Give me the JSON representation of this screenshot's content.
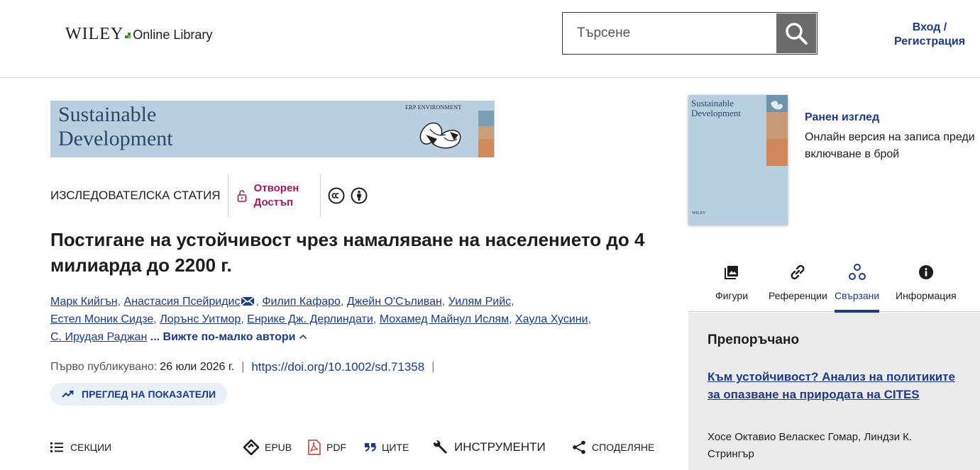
{
  "header": {
    "logo_wordmark": "WILEY",
    "logo_library": "Online Library",
    "search_placeholder": "Търсене",
    "login_line1": "Вход /",
    "login_line2": "Регистрация"
  },
  "banner": {
    "journal_title_line1": "Sustainable",
    "journal_title_line2": "Development",
    "publisher_mark": "ERP ENVIRONMENT"
  },
  "article": {
    "type": "ИЗСЛЕДОВАТЕЛСКА СТАТИЯ",
    "access_line1": "Отворен",
    "access_line2": "Достъп",
    "title": "Постигане на устойчивост чрез намаляване на населението до 4 милиарда до 2200 г.",
    "authors": [
      "Марк Кийгън",
      "Анастасия Псейридис",
      "Филип Кафаро",
      "Джейн О'Съливан",
      "Уилям Рийс",
      "Естел Моник Сидзе",
      "Лорънс Уитмор",
      "Енрике Дж. Дерлиндати",
      "Мохамед Майнул Ислям",
      "Хаула Хусини",
      "С. Ирудая Раджан"
    ],
    "less_authors_label": "... Вижте по-малко автори",
    "published_label": "Първо публикувано:",
    "published_date": "26 юли 2026 г.",
    "doi": "https://doi.org/10.1002/sd.71358",
    "metrics_label": "ПРЕГЛЕД НА ПОКАЗАТЕЛИ"
  },
  "toolbar": {
    "sections": "СЕКЦИИ",
    "epub": "EPUB",
    "pdf": "PDF",
    "cite": "ЦИТЕ",
    "tools": "ИНСТРУМЕНТИ",
    "share": "СПОДЕЛЯНЕ"
  },
  "sidebar": {
    "cover_title_line1": "Sustainable",
    "cover_title_line2": "Development",
    "cover_publisher": "WILEY",
    "early_view_title": "Ранен изглед",
    "early_view_desc": "Онлайн версия на записа преди включване в брой",
    "tabs": [
      {
        "label": "Фигури",
        "icon": "image-icon"
      },
      {
        "label": "Референции",
        "icon": "link-icon"
      },
      {
        "label": "Свързани",
        "icon": "related-icon"
      },
      {
        "label": "Информация",
        "icon": "info-icon"
      }
    ],
    "active_tab": "Свързани",
    "recommended_heading": "Препоръчано",
    "recommended_title": "Към устойчивост? Анализ на политиките за опазване на природата на CITES",
    "recommended_authors": "Хосе Октавио Веласкес Гомар, Линдзи К. Стрингър"
  },
  "colors": {
    "link_blue": "#1a3b8a",
    "open_access_magenta": "#a6185d",
    "banner_blue": "#b9cfe0",
    "search_button": "#6b6b6b",
    "panel_grey": "#ebebeb"
  }
}
